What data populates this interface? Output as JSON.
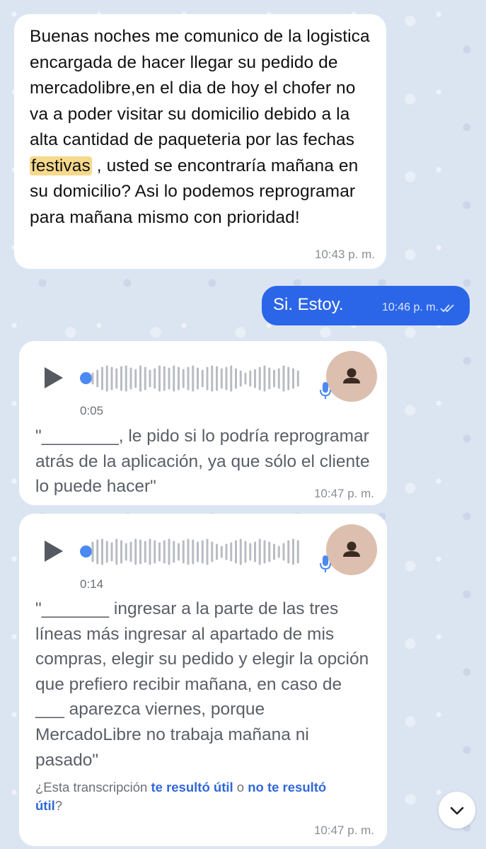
{
  "messages": {
    "incoming_text": {
      "before": "Buenas noches me comunico de la logistica encargada de hacer llegar su pedido de mercadolibre,en el dia de hoy el chofer no va a poder visitar su domicilio debido a la alta cantidad de paqueteria por las fechas ",
      "highlight": "festivas",
      "after": " , usted se encontraría mañana en su domicilio? Asi lo podemos reprogramar para mañana mismo con prioridad!",
      "time": "10:43 p. m."
    },
    "outgoing": {
      "text": "Si. Estoy.",
      "time": "10:46 p. m.",
      "status_icon": "double-check-icon"
    },
    "voice1": {
      "duration": "0:05",
      "transcript": "\"________, le pido si lo podría reprogramar atrás de la aplicación, ya que sólo el cliente lo puede hacer\"",
      "time": "10:47 p. m."
    },
    "voice2": {
      "duration": "0:14",
      "transcript": "\"_______ ingresar a la parte de las tres líneas más ingresar al apartado de mis compras, elegir su pedido y elegir la opción que prefiero recibir mañana, en caso de ___ aparezca viernes, porque MercadoLibre no trabaja mañana ni pasado\"",
      "feedback_prefix": "¿Esta transcripción ",
      "feedback_yes": "te resultó útil",
      "feedback_or": " o ",
      "feedback_no": "no te resultó útil",
      "feedback_suffix": "?",
      "time": "10:47 p. m."
    }
  },
  "colors": {
    "outgoing_bubble": "#2b66e8",
    "link": "#3168d8",
    "highlight": "#f7d98c"
  }
}
